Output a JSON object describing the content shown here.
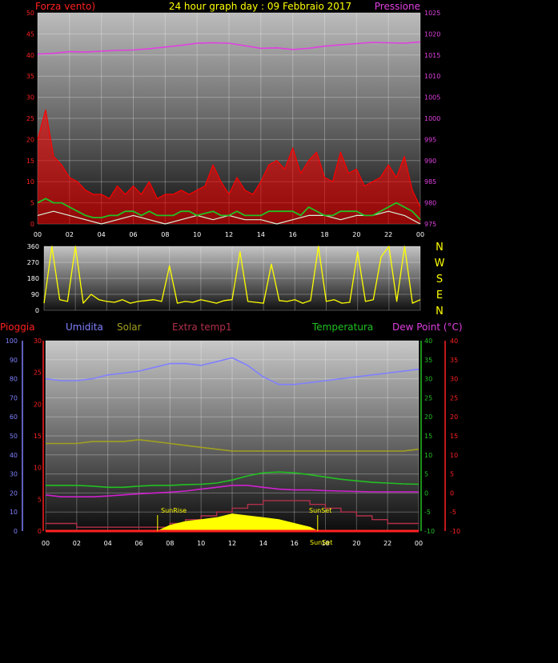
{
  "header": {
    "left_title": "Forza vento)",
    "center_title": "24 hour graph day : 09 Febbraio 2017",
    "right_title": "Pressione"
  },
  "legend_bottom": {
    "rain": "Pioggia",
    "humidity": "Umidita",
    "solar": "Solar",
    "extra_temp": "Extra temp1",
    "temperature": "Temperatura",
    "dew_point": "Dew Point (°C)"
  },
  "compass": [
    "N",
    "W",
    "S",
    "E",
    "N"
  ],
  "x_ticks": [
    "00",
    "02",
    "04",
    "06",
    "08",
    "10",
    "12",
    "14",
    "16",
    "18",
    "20",
    "22",
    "00"
  ],
  "markers": {
    "sunrise": "SunRise",
    "sunset": "SunSet",
    "sunset_axis": "SunSet"
  },
  "colors": {
    "wind_axis": "#ff2020",
    "pressure": "#e040e0",
    "wind_gust": "#ff0000",
    "wind_avg": "#22c022",
    "wind_low": "#d8f0d8",
    "direction": "#ffff00",
    "humidity": "#8080ff",
    "solar": "#a0a020",
    "extra_temp": "#b0304a",
    "temperature": "#22c022",
    "dew_point": "#d020d0",
    "solar_fill": "#ffff00",
    "rain": "#ff2020"
  },
  "chart_data": [
    {
      "id": "wind_pressure",
      "type": "line",
      "x_unit": "hour",
      "xlim": [
        0,
        24
      ],
      "y_left": {
        "label": "Forza vento)",
        "ylim": [
          0,
          50
        ],
        "ticks": [
          0,
          5,
          10,
          15,
          20,
          25,
          30,
          35,
          40,
          45,
          50
        ]
      },
      "y_right": {
        "label": "Pressione",
        "ylim": [
          975,
          1025
        ],
        "ticks": [
          975,
          980,
          985,
          990,
          995,
          1000,
          1005,
          1010,
          1015,
          1020,
          1025
        ]
      },
      "grid": true,
      "series": [
        {
          "key": "pressure",
          "axis": "right",
          "x": [
            0,
            1,
            2,
            3,
            4,
            5,
            6,
            7,
            8,
            9,
            10,
            11,
            12,
            13,
            14,
            15,
            16,
            17,
            18,
            19,
            20,
            21,
            22,
            23,
            24
          ],
          "values": [
            1015.2,
            1015.4,
            1015.8,
            1015.7,
            1015.9,
            1016.1,
            1016.2,
            1016.5,
            1016.9,
            1017.3,
            1017.8,
            1017.9,
            1017.8,
            1017.2,
            1016.6,
            1016.7,
            1016.3,
            1016.6,
            1017.1,
            1017.4,
            1017.7,
            1018.0,
            1017.9,
            1017.8,
            1018.1
          ]
        },
        {
          "key": "gust",
          "axis": "left",
          "x": [
            0,
            0.5,
            1,
            1.5,
            2,
            2.5,
            3,
            3.5,
            4,
            4.5,
            5,
            5.5,
            6,
            6.5,
            7,
            7.5,
            8,
            8.5,
            9,
            9.5,
            10,
            10.5,
            11,
            11.5,
            12,
            12.5,
            13,
            13.5,
            14,
            14.5,
            15,
            15.5,
            16,
            16.5,
            17,
            17.5,
            18,
            18.5,
            19,
            19.5,
            20,
            20.5,
            21,
            21.5,
            22,
            22.5,
            23,
            23.5,
            24
          ],
          "values": [
            20,
            27,
            16,
            14,
            11,
            10,
            8,
            7,
            7,
            6,
            9,
            7,
            9,
            7,
            10,
            6,
            7,
            7,
            8,
            7,
            8,
            9,
            14,
            10,
            7,
            11,
            8,
            7,
            10,
            14,
            15,
            13,
            18,
            12,
            15,
            17,
            11,
            10,
            17,
            12,
            13,
            9,
            10,
            11,
            14,
            11,
            16,
            8,
            4
          ]
        },
        {
          "key": "avg",
          "axis": "left",
          "x": [
            0,
            0.5,
            1,
            1.5,
            2,
            2.5,
            3,
            3.5,
            4,
            4.5,
            5,
            5.5,
            6,
            6.5,
            7,
            7.5,
            8,
            8.5,
            9,
            9.5,
            10,
            10.5,
            11,
            11.5,
            12,
            12.5,
            13,
            13.5,
            14,
            14.5,
            15,
            15.5,
            16,
            16.5,
            17,
            17.5,
            18,
            18.5,
            19,
            19.5,
            20,
            20.5,
            21,
            21.5,
            22,
            22.5,
            23,
            23.5,
            24
          ],
          "values": [
            5,
            6,
            5,
            5,
            4,
            3,
            2,
            1.5,
            1.5,
            2,
            2,
            3,
            3,
            2,
            3,
            2,
            2,
            2,
            3,
            3,
            2,
            2.5,
            3,
            2,
            2,
            3,
            2,
            2,
            2,
            3,
            3,
            3,
            3,
            2,
            4,
            3,
            2,
            2,
            3,
            3,
            3,
            2,
            2,
            3,
            4,
            5,
            4,
            3,
            1
          ]
        },
        {
          "key": "low",
          "axis": "left",
          "x": [
            0,
            1,
            2,
            3,
            4,
            5,
            6,
            7,
            8,
            9,
            10,
            11,
            12,
            13,
            14,
            15,
            16,
            17,
            18,
            19,
            20,
            21,
            22,
            23,
            24
          ],
          "values": [
            2,
            3,
            2,
            1,
            0,
            1,
            2,
            1,
            0,
            1,
            2,
            1,
            2,
            1,
            1,
            0,
            1,
            2,
            2,
            1,
            2,
            2,
            3,
            2,
            0
          ]
        }
      ]
    },
    {
      "id": "wind_direction",
      "type": "line",
      "x_unit": "hour",
      "xlim": [
        0,
        24
      ],
      "ylim": [
        0,
        360
      ],
      "y_ticks": [
        0,
        90,
        180,
        270,
        360
      ],
      "compass": [
        "N",
        "W",
        "S",
        "E",
        "N"
      ],
      "grid": true,
      "series": [
        {
          "key": "direction",
          "x": [
            0,
            0.5,
            1,
            1.5,
            2,
            2.5,
            3,
            3.5,
            4,
            4.5,
            5,
            5.5,
            6,
            6.5,
            7,
            7.5,
            8,
            8.5,
            9,
            9.5,
            10,
            10.5,
            11,
            11.5,
            12,
            12.5,
            13,
            13.5,
            14,
            14.5,
            15,
            15.5,
            16,
            16.5,
            17,
            17.5,
            18,
            18.5,
            19,
            19.5,
            20,
            20.5,
            21,
            21.5,
            22,
            22.5,
            23,
            23.5,
            24
          ],
          "values": [
            40,
            360,
            60,
            50,
            360,
            40,
            90,
            60,
            50,
            45,
            60,
            40,
            50,
            55,
            60,
            50,
            250,
            40,
            50,
            45,
            60,
            50,
            40,
            55,
            60,
            330,
            50,
            45,
            40,
            260,
            55,
            50,
            60,
            40,
            55,
            360,
            50,
            60,
            40,
            45,
            330,
            50,
            60,
            300,
            360,
            50,
            360,
            40,
            60
          ]
        }
      ]
    },
    {
      "id": "meteo_lower",
      "type": "line",
      "x_unit": "hour",
      "xlim": [
        0,
        24
      ],
      "grid": true,
      "axes": {
        "rain": {
          "ylim": [
            0,
            100
          ],
          "ticks": [
            0,
            10,
            20,
            30,
            40,
            50,
            60,
            70,
            80,
            90,
            100
          ]
        },
        "rain_mm": {
          "ylim": [
            0,
            30
          ],
          "ticks": [
            0,
            5,
            10,
            15,
            20,
            25,
            30
          ]
        },
        "temperature": {
          "ylim": [
            -10,
            40
          ],
          "ticks": [
            -10,
            -5,
            0,
            5,
            10,
            15,
            20,
            25,
            30,
            35,
            40
          ]
        },
        "dew_point": {
          "ylim": [
            -10,
            40
          ],
          "ticks": [
            -10,
            -5,
            0,
            5,
            10,
            15,
            20,
            25,
            30,
            35,
            40
          ]
        }
      },
      "events": {
        "sunrise_hour": 7.2,
        "sunset_hour": 17.5
      },
      "series": [
        {
          "key": "humidity",
          "name": "Umidita",
          "axis": "rain",
          "x": [
            0,
            1,
            2,
            3,
            4,
            5,
            6,
            7,
            8,
            9,
            10,
            11,
            12,
            13,
            14,
            15,
            16,
            17,
            18,
            19,
            20,
            21,
            22,
            23,
            24
          ],
          "values": [
            80,
            79,
            79,
            80,
            82,
            83,
            84,
            86,
            88,
            88,
            87,
            89,
            91,
            87,
            81,
            77,
            77,
            78,
            79,
            80,
            81,
            82,
            83,
            84,
            85
          ]
        },
        {
          "key": "solar",
          "name": "Solar",
          "axis": "temperature",
          "x": [
            0,
            1,
            2,
            3,
            4,
            5,
            6,
            7,
            8,
            9,
            10,
            11,
            12,
            13,
            14,
            15,
            16,
            17,
            18,
            19,
            20,
            21,
            22,
            23,
            24
          ],
          "values": [
            13,
            13,
            13,
            13.5,
            13.5,
            13.5,
            14,
            13.5,
            13,
            12.5,
            12,
            11.5,
            11,
            11,
            11,
            11,
            11,
            11,
            11,
            11,
            11,
            11,
            11,
            11,
            11.5
          ]
        },
        {
          "key": "extra_temp",
          "name": "Extra temp1",
          "axis": "dew_point",
          "x": [
            0,
            1,
            2,
            3,
            4,
            5,
            6,
            7,
            8,
            9,
            10,
            11,
            12,
            13,
            14,
            15,
            16,
            17,
            18,
            19,
            20,
            21,
            22,
            23,
            24
          ],
          "values": [
            -8,
            -8,
            -9,
            -9,
            -9,
            -9,
            -9,
            -9,
            -8,
            -7,
            -6,
            -5,
            -4,
            -3,
            -2,
            -2,
            -2,
            -3,
            -4,
            -5,
            -6,
            -7,
            -8,
            -8,
            -8
          ]
        },
        {
          "key": "temperature",
          "name": "Temperatura",
          "axis": "temperature",
          "x": [
            0,
            1,
            2,
            3,
            4,
            5,
            6,
            7,
            8,
            9,
            10,
            11,
            12,
            13,
            14,
            15,
            16,
            17,
            18,
            19,
            20,
            21,
            22,
            23,
            24
          ],
          "values": [
            2,
            2,
            2,
            1.8,
            1.5,
            1.5,
            1.8,
            2,
            2,
            2.2,
            2.3,
            2.6,
            3.4,
            4.5,
            5.3,
            5.5,
            5.3,
            4.8,
            4.2,
            3.6,
            3.2,
            2.8,
            2.6,
            2.4,
            2.3
          ]
        },
        {
          "key": "dew_point",
          "name": "Dew Point (°C)",
          "axis": "dew_point",
          "x": [
            0,
            1,
            2,
            3,
            4,
            5,
            6,
            7,
            8,
            9,
            10,
            11,
            12,
            13,
            14,
            15,
            16,
            17,
            18,
            19,
            20,
            21,
            22,
            23,
            24
          ],
          "values": [
            -0.5,
            -1,
            -1,
            -1,
            -0.8,
            -0.5,
            -0.2,
            0,
            0.2,
            0.5,
            1,
            1.5,
            2,
            2,
            1.5,
            1,
            0.8,
            0.8,
            0.6,
            0.5,
            0.4,
            0.3,
            0.3,
            0.3,
            0.3
          ]
        },
        {
          "key": "solar_rad",
          "type": "area",
          "axis": "temperature",
          "x": [
            7.2,
            8,
            9,
            10,
            11,
            12,
            13,
            14,
            15,
            16,
            17,
            17.5
          ],
          "values": [
            -10,
            -8.5,
            -7.5,
            -7,
            -6.5,
            -5.5,
            -6,
            -6.5,
            -7,
            -8,
            -9,
            -10
          ]
        },
        {
          "key": "rain",
          "name": "Pioggia",
          "axis": "rain",
          "x": [
            0,
            24
          ],
          "values": [
            0,
            0
          ]
        }
      ]
    }
  ]
}
